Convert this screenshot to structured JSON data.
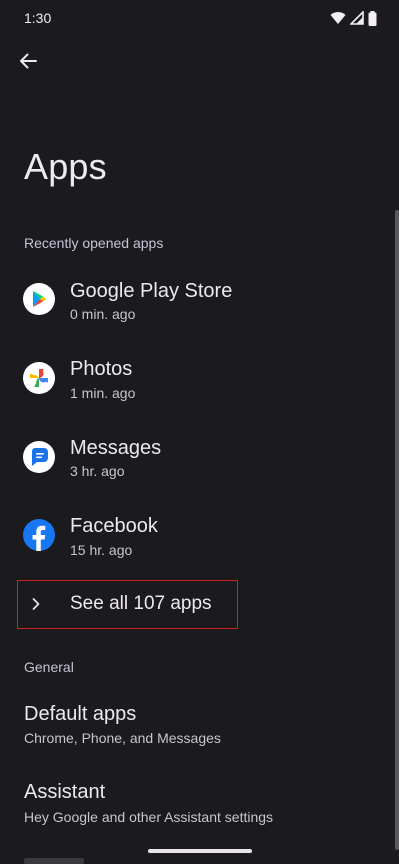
{
  "status_bar": {
    "time": "1:30",
    "icons": [
      "wifi-icon",
      "signal-icon",
      "battery-icon"
    ]
  },
  "header": {
    "back_icon": "arrow-back-icon",
    "title": "Apps"
  },
  "recent": {
    "header": "Recently opened apps",
    "apps": [
      {
        "name": "Google Play Store",
        "time": "0 min. ago",
        "icon": "google-play-store-icon"
      },
      {
        "name": "Photos",
        "time": "1 min. ago",
        "icon": "google-photos-icon"
      },
      {
        "name": "Messages",
        "time": "3 hr. ago",
        "icon": "messages-icon"
      },
      {
        "name": "Facebook",
        "time": "15 hr. ago",
        "icon": "facebook-icon"
      }
    ],
    "see_all_label": "See all 107 apps"
  },
  "general": {
    "header": "General",
    "items": [
      {
        "title": "Default apps",
        "subtitle": "Chrome, Phone, and Messages"
      },
      {
        "title": "Assistant",
        "subtitle": "Hey Google and other Assistant settings"
      }
    ]
  },
  "colors": {
    "background": "#1b1a1e",
    "highlight_border": "#d11f26",
    "facebook_blue": "#1877f2",
    "messages_blue": "#1a73e8"
  }
}
